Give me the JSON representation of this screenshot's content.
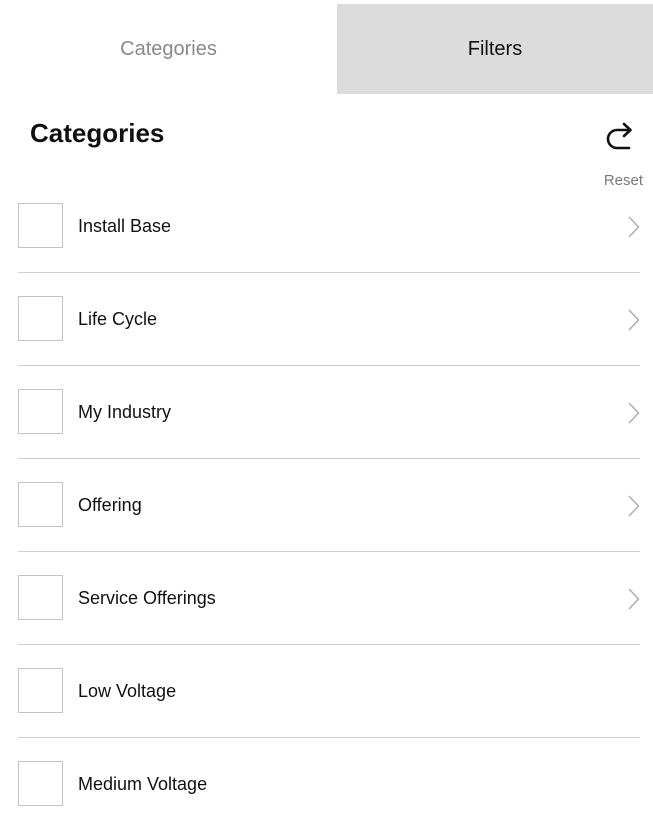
{
  "tabs": [
    {
      "label": "Categories",
      "active": true
    },
    {
      "label": "Filters",
      "active": false
    }
  ],
  "header": {
    "title": "Categories",
    "reset_label": "Reset",
    "reset_icon": "redo-arrow-icon"
  },
  "categories": [
    {
      "label": "Install Base",
      "has_children": true,
      "checked": false
    },
    {
      "label": "Life Cycle",
      "has_children": true,
      "checked": false
    },
    {
      "label": "My Industry",
      "has_children": true,
      "checked": false
    },
    {
      "label": "Offering",
      "has_children": true,
      "checked": false
    },
    {
      "label": "Service Offerings",
      "has_children": true,
      "checked": false
    },
    {
      "label": "Low Voltage",
      "has_children": false,
      "checked": false
    },
    {
      "label": "Medium Voltage",
      "has_children": false,
      "checked": false
    }
  ],
  "colors": {
    "inactive_tab_bg": "#dcdcdc",
    "divider": "#cfcfcf",
    "muted_text": "#8a8a8a"
  }
}
